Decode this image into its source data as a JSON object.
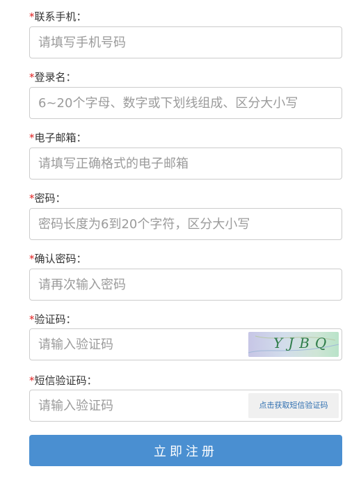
{
  "required_mark": "*",
  "fields": {
    "phone": {
      "label": "联系手机：",
      "placeholder": "请填写手机号码",
      "value": ""
    },
    "username": {
      "label": "登录名：",
      "placeholder": "6~20个字母、数字或下划线组成、区分大小写",
      "value": ""
    },
    "email": {
      "label": "电子邮箱：",
      "placeholder": "请填写正确格式的电子邮箱",
      "value": ""
    },
    "password": {
      "label": "密码：",
      "placeholder": "密码长度为6到20个字符，区分大小写",
      "value": ""
    },
    "confirm_password": {
      "label": "确认密码：",
      "placeholder": "请再次输入密码",
      "value": ""
    },
    "captcha": {
      "label": "验证码：",
      "placeholder": "请输入验证码",
      "value": "",
      "image_text": "YJBQ"
    },
    "sms_code": {
      "label": "短信验证码：",
      "placeholder": "请输入验证码",
      "value": "",
      "button_label": "点击获取短信验证码"
    }
  },
  "submit_label": "立即注册",
  "colors": {
    "required": "#e02020",
    "primary": "#4a8fd1",
    "link": "#2f6fb0",
    "border": "#cccccc"
  }
}
